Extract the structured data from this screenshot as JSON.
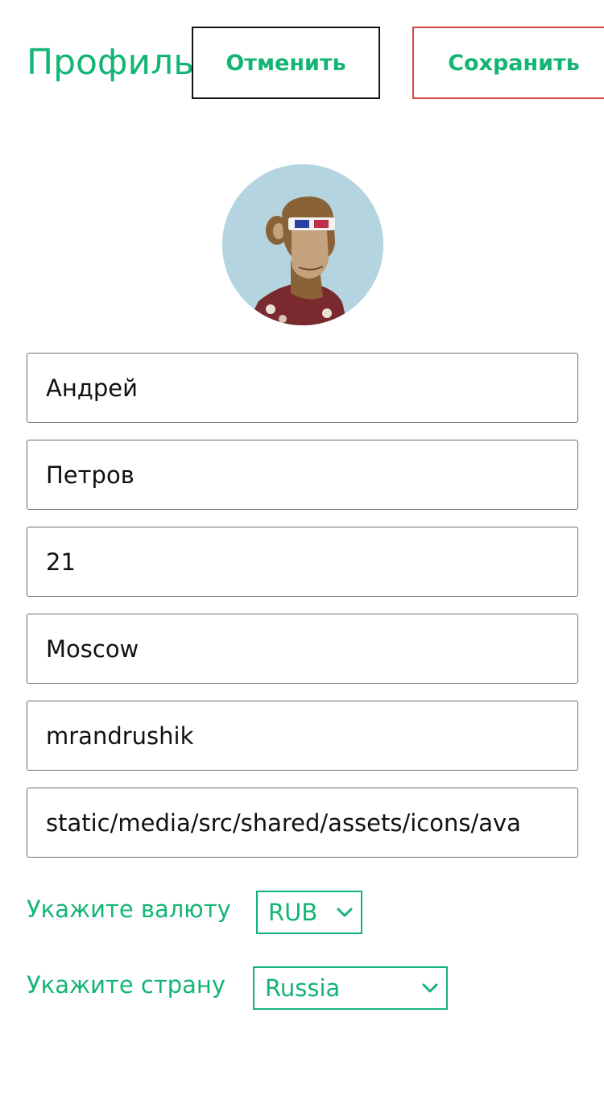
{
  "header": {
    "title": "Профиль",
    "cancel_label": "Отменить",
    "save_label": "Сохранить"
  },
  "avatar": {
    "description_icon": "bored-ape-avatar"
  },
  "form": {
    "first_name": "Андрей",
    "last_name": "Петров",
    "age": "21",
    "city": "Moscow",
    "username": "mrandrushik",
    "avatar_path": "static/media/src/shared/assets/icons/ava"
  },
  "currency": {
    "label": "Укажите валюту",
    "value": "RUB"
  },
  "country": {
    "label": "Укажите страну",
    "value": "Russia"
  },
  "colors": {
    "accent": "#13b576",
    "cancel_border": "#111111",
    "save_border": "#d94141",
    "avatar_bg": "#b4d5e0"
  }
}
